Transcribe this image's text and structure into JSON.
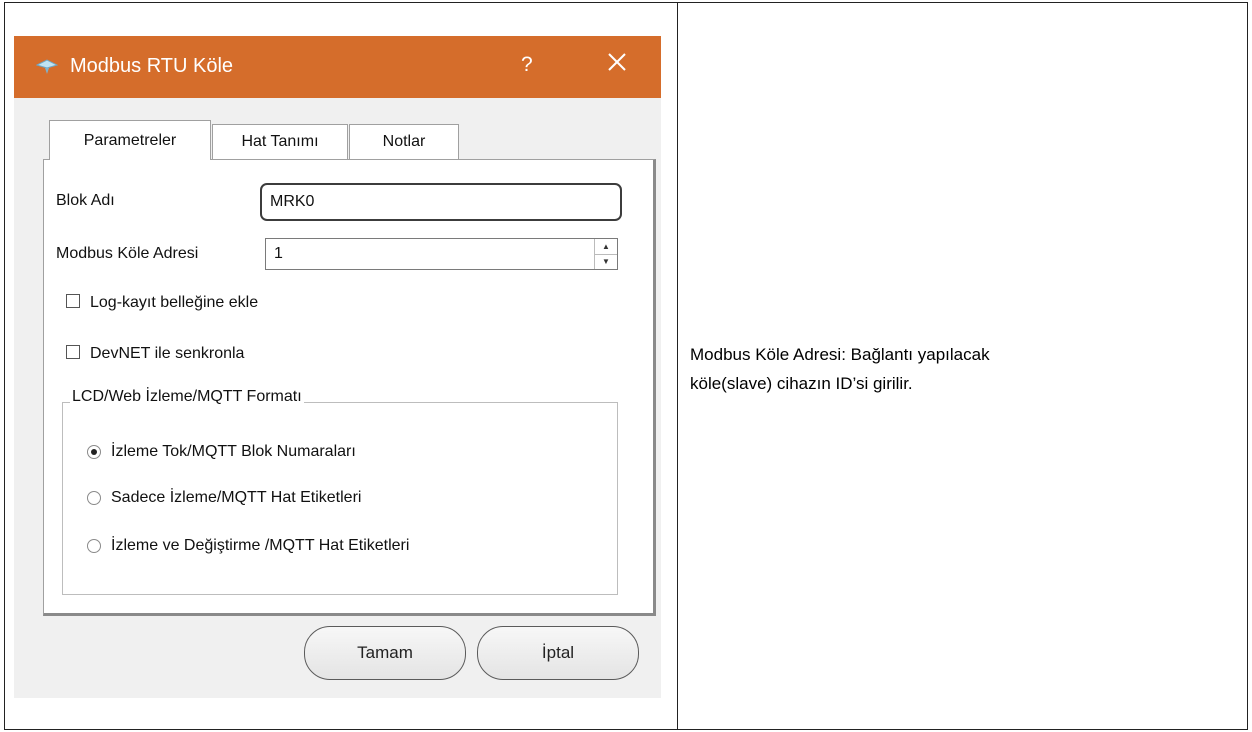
{
  "dialog": {
    "title": "Modbus RTU Köle",
    "help_label": "?",
    "tabs": [
      {
        "label": "Parametreler",
        "active": true
      },
      {
        "label": "Hat Tanımı",
        "active": false
      },
      {
        "label": "Notlar",
        "active": false
      }
    ],
    "fields": {
      "block_name_label": "Blok Adı",
      "block_name_value": "MRK0",
      "slave_address_label": "Modbus Köle Adresi",
      "slave_address_value": "1"
    },
    "checkboxes": [
      {
        "label": "Log-kayıt belleğine ekle",
        "checked": false
      },
      {
        "label": "DevNET ile senkronla",
        "checked": false
      }
    ],
    "group": {
      "title": "LCD/Web İzleme/MQTT Formatı",
      "options": [
        {
          "label": "İzleme Tok/MQTT Blok Numaraları",
          "checked": true
        },
        {
          "label": "Sadece İzleme/MQTT Hat Etiketleri",
          "checked": false
        },
        {
          "label": "İzleme ve Değiştirme /MQTT Hat Etiketleri",
          "checked": false
        }
      ]
    },
    "buttons": {
      "ok_label": "Tamam",
      "cancel_label": "İptal"
    },
    "colors": {
      "titlebar": "#d56d2b"
    }
  },
  "description": {
    "line1": "Modbus Köle Adresi:  Bağlantı yapılacak",
    "line2": "köle(slave) cihazın ID’si girilir."
  }
}
